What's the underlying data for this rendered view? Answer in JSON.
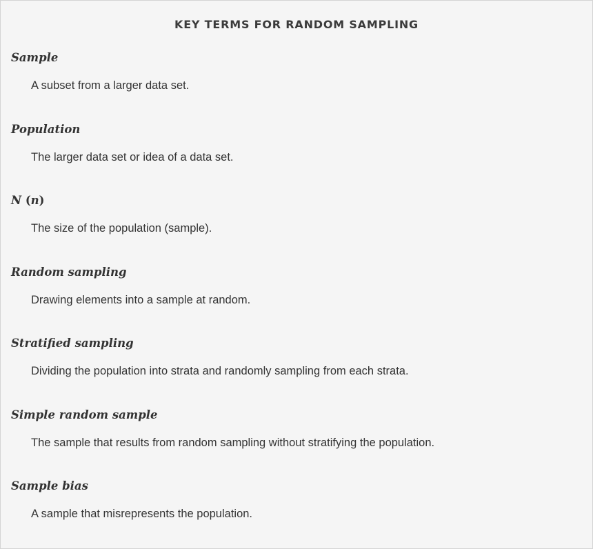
{
  "title": "KEY TERMS FOR RANDOM SAMPLING",
  "terms": [
    {
      "term": "Sample",
      "definition": "A subset from a larger data set."
    },
    {
      "term": "Population",
      "definition": "The larger data set or idea of a data set."
    },
    {
      "term_parts": {
        "main": "N",
        "open": " (",
        "inner": "n",
        "close": ")"
      },
      "definition": "The size of the population (sample)."
    },
    {
      "term": "Random sampling",
      "definition": "Drawing elements into a sample at random."
    },
    {
      "term": "Stratified sampling",
      "definition": "Dividing the population into strata and randomly sampling from each strata."
    },
    {
      "term": "Simple random sample",
      "definition": "The sample that results from random sampling without stratifying the population."
    },
    {
      "term": "Sample bias",
      "definition": "A sample that misrepresents the population."
    }
  ]
}
